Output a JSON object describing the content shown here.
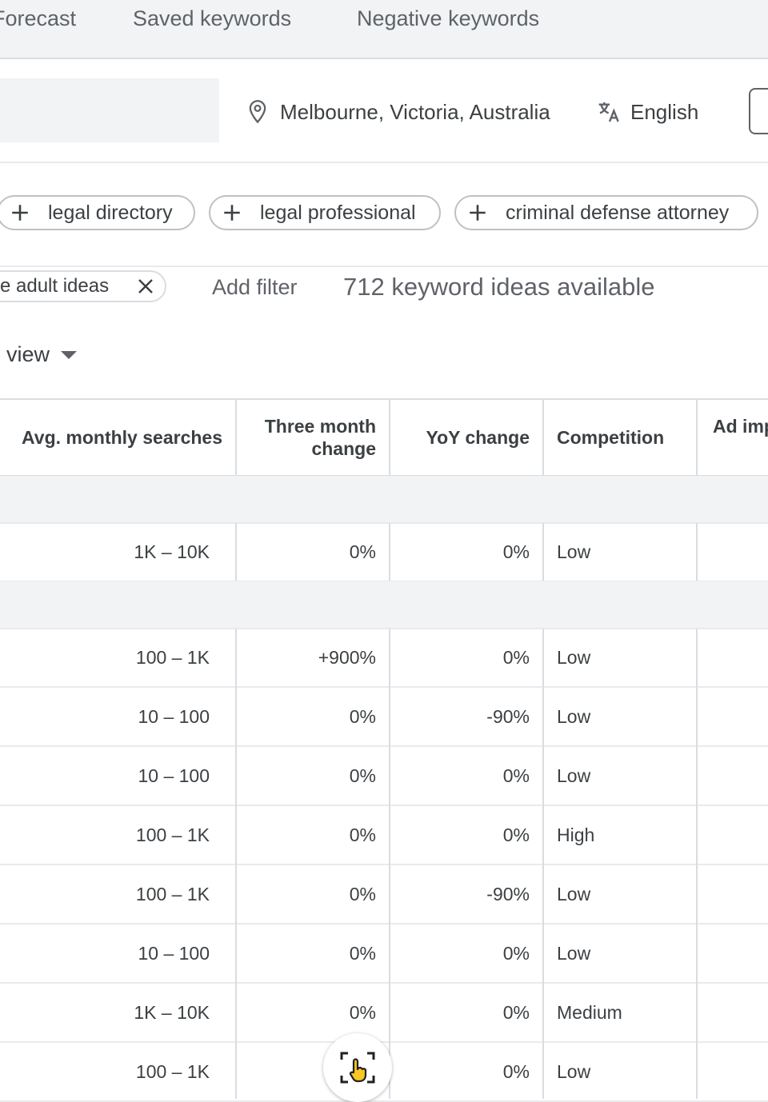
{
  "tabs": [
    "Forecast",
    "Saved keywords",
    "Negative keywords"
  ],
  "targeting": {
    "location": "Melbourne, Victoria, Australia",
    "language": "English"
  },
  "suggestion_chips": [
    "legal directory",
    "legal professional",
    "criminal defense attorney"
  ],
  "filters": {
    "active_filter": "e adult ideas",
    "add_filter_label": "Add filter",
    "ideas_count_text": "712 keyword ideas available",
    "view_label": "view"
  },
  "table": {
    "headers": {
      "avg_monthly": "Avg. monthly searches",
      "three_month": "Three month change",
      "yoy": "YoY change",
      "competition": "Competition",
      "ad_imp": "Ad imp"
    },
    "group1_rows": [
      {
        "avg": "1K – 10K",
        "three": "0%",
        "yoy": "0%",
        "comp": "Low"
      }
    ],
    "group2_rows": [
      {
        "avg": "100 – 1K",
        "three": "+900%",
        "yoy": "0%",
        "comp": "Low"
      },
      {
        "avg": "10 – 100",
        "three": "0%",
        "yoy": "-90%",
        "comp": "Low"
      },
      {
        "avg": "10 – 100",
        "three": "0%",
        "yoy": "0%",
        "comp": "Low"
      },
      {
        "avg": "100 – 1K",
        "three": "0%",
        "yoy": "0%",
        "comp": "High"
      },
      {
        "avg": "100 – 1K",
        "three": "0%",
        "yoy": "-90%",
        "comp": "Low"
      },
      {
        "avg": "10 – 100",
        "three": "0%",
        "yoy": "0%",
        "comp": "Low"
      },
      {
        "avg": "1K – 10K",
        "three": "0%",
        "yoy": "0%",
        "comp": "Medium"
      },
      {
        "avg": "100 – 1K",
        "three": "",
        "yoy": "0%",
        "comp": "Low"
      }
    ]
  },
  "icons": {
    "location": "location-pin-icon",
    "language": "translate-icon",
    "chip_add": "plus-icon",
    "filter_remove": "close-icon",
    "view_dropdown": "caret-down-icon",
    "fab": "screen-capture-hand-icon"
  },
  "colors": {
    "fab_hand": "#f9c623"
  }
}
